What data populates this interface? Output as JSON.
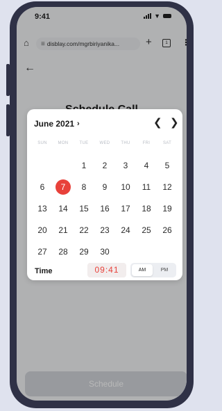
{
  "status_bar": {
    "time": "9:41"
  },
  "browser": {
    "url": "disblay.com/mgrbiriyanika...",
    "tab_count": "1"
  },
  "page": {
    "title": "Schedule Call",
    "schedule_button": "Schedule"
  },
  "picker": {
    "month_label": "June 2021",
    "weekdays": [
      "SUN",
      "MON",
      "TUE",
      "WED",
      "THU",
      "FRI",
      "SAT"
    ],
    "weeks": [
      [
        "",
        "",
        "1",
        "2",
        "3",
        "4",
        "5"
      ],
      [
        "6",
        "7",
        "8",
        "9",
        "10",
        "11",
        "12"
      ],
      [
        "13",
        "14",
        "15",
        "16",
        "17",
        "18",
        "19"
      ],
      [
        "20",
        "21",
        "22",
        "23",
        "24",
        "25",
        "26"
      ],
      [
        "27",
        "28",
        "29",
        "30",
        "",
        "",
        ""
      ]
    ],
    "selected_day": "7",
    "time_label": "Time",
    "time_value": "09:41",
    "am_label": "AM",
    "pm_label": "PM",
    "selected_period": "AM"
  },
  "colors": {
    "accent": "#e8413a",
    "phone_frame": "#2f3146"
  }
}
